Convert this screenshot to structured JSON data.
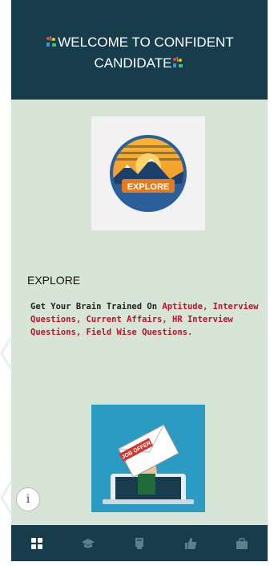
{
  "header": {
    "title_line1": "WELCOME TO CONFIDENT",
    "title_line2": "CANDIDATE",
    "bg_color": "#173d4c"
  },
  "explore_logo": {
    "text": "EXPLORE",
    "colors": {
      "ring": "#2a5f9c",
      "sun": "#f39c2d",
      "mountain": "#1d3f6b"
    }
  },
  "section": {
    "title": "EXPLORE",
    "desc_prefix": "Get Your Brain Trained On ",
    "desc_highlight": "Aptitude, Interview Questions, Current Affairs, HR Interview Questions, Field Wise Questions."
  },
  "offer_image": {
    "letter_label": "JOB OFFER"
  },
  "info_button": {
    "icon": "info-icon",
    "glyph": "i"
  },
  "bottom_nav": {
    "items": [
      {
        "icon": "grid-icon",
        "active": true
      },
      {
        "icon": "graduation-cap-icon",
        "active": false
      },
      {
        "icon": "book-icon",
        "active": false
      },
      {
        "icon": "thumbs-up-icon",
        "active": false
      },
      {
        "icon": "briefcase-icon",
        "active": false
      }
    ],
    "active_color": "#ffffff",
    "inactive_color": "#5f7f8b"
  },
  "accent_highlight_color": "#c0112a"
}
